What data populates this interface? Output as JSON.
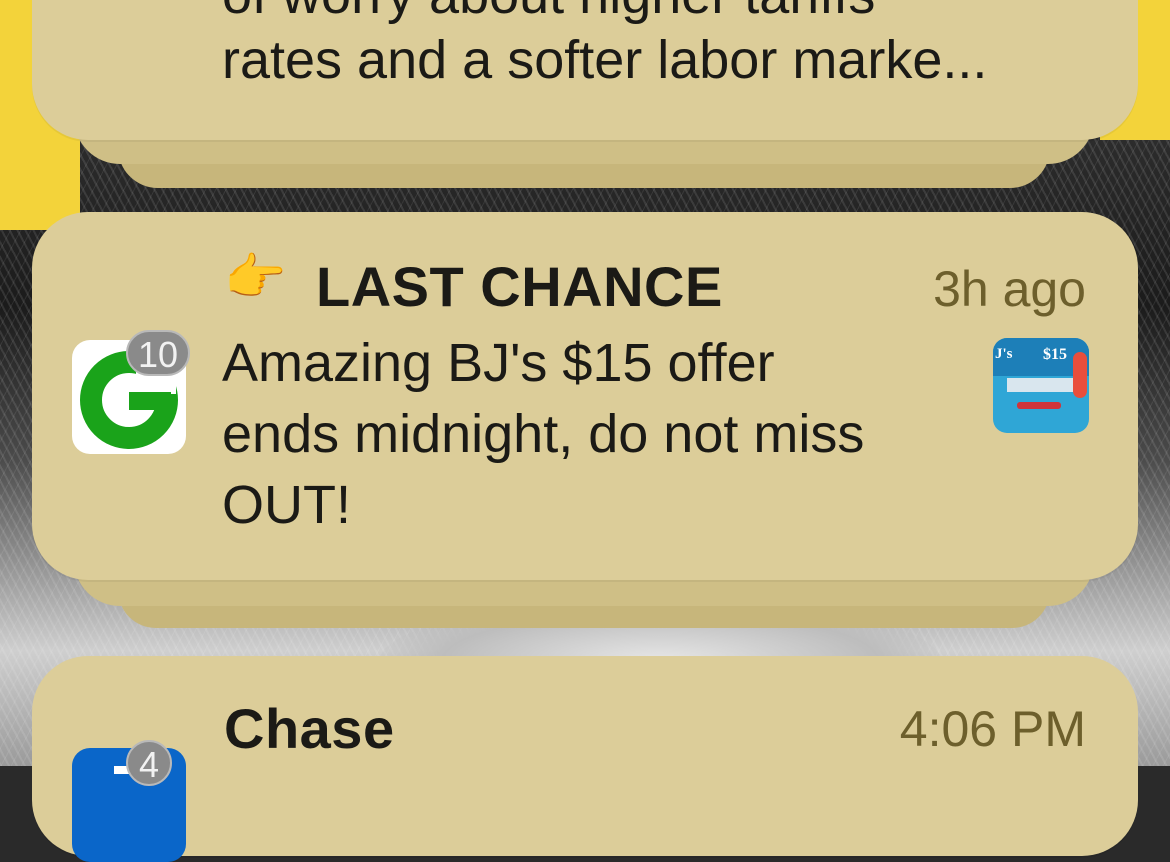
{
  "notifications": [
    {
      "body_partial_top": "of worry about higher tariffs",
      "body_last_line": "rates and a softer labor marke..."
    },
    {
      "title_emoji": "👉",
      "title": "LAST CHANCE",
      "time": "3h ago",
      "app_icon": "groupon-g-icon",
      "app_icon_letter": "G",
      "badge_count": "10",
      "body_lines": [
        "Amazing BJ's $15 offer",
        "ends midnight, do not miss",
        "OUT!"
      ],
      "thumbnail": {
        "text_left": "J's",
        "text_right": "$15"
      }
    },
    {
      "title": "Chase",
      "time": "4:06 PM",
      "badge_count": "4",
      "app_icon": "chase-app-icon"
    }
  ],
  "colors": {
    "card": "#dccd99",
    "time": "#6d5f2c",
    "groupon_green": "#1aa31a",
    "chase_blue": "#0a66c9"
  }
}
